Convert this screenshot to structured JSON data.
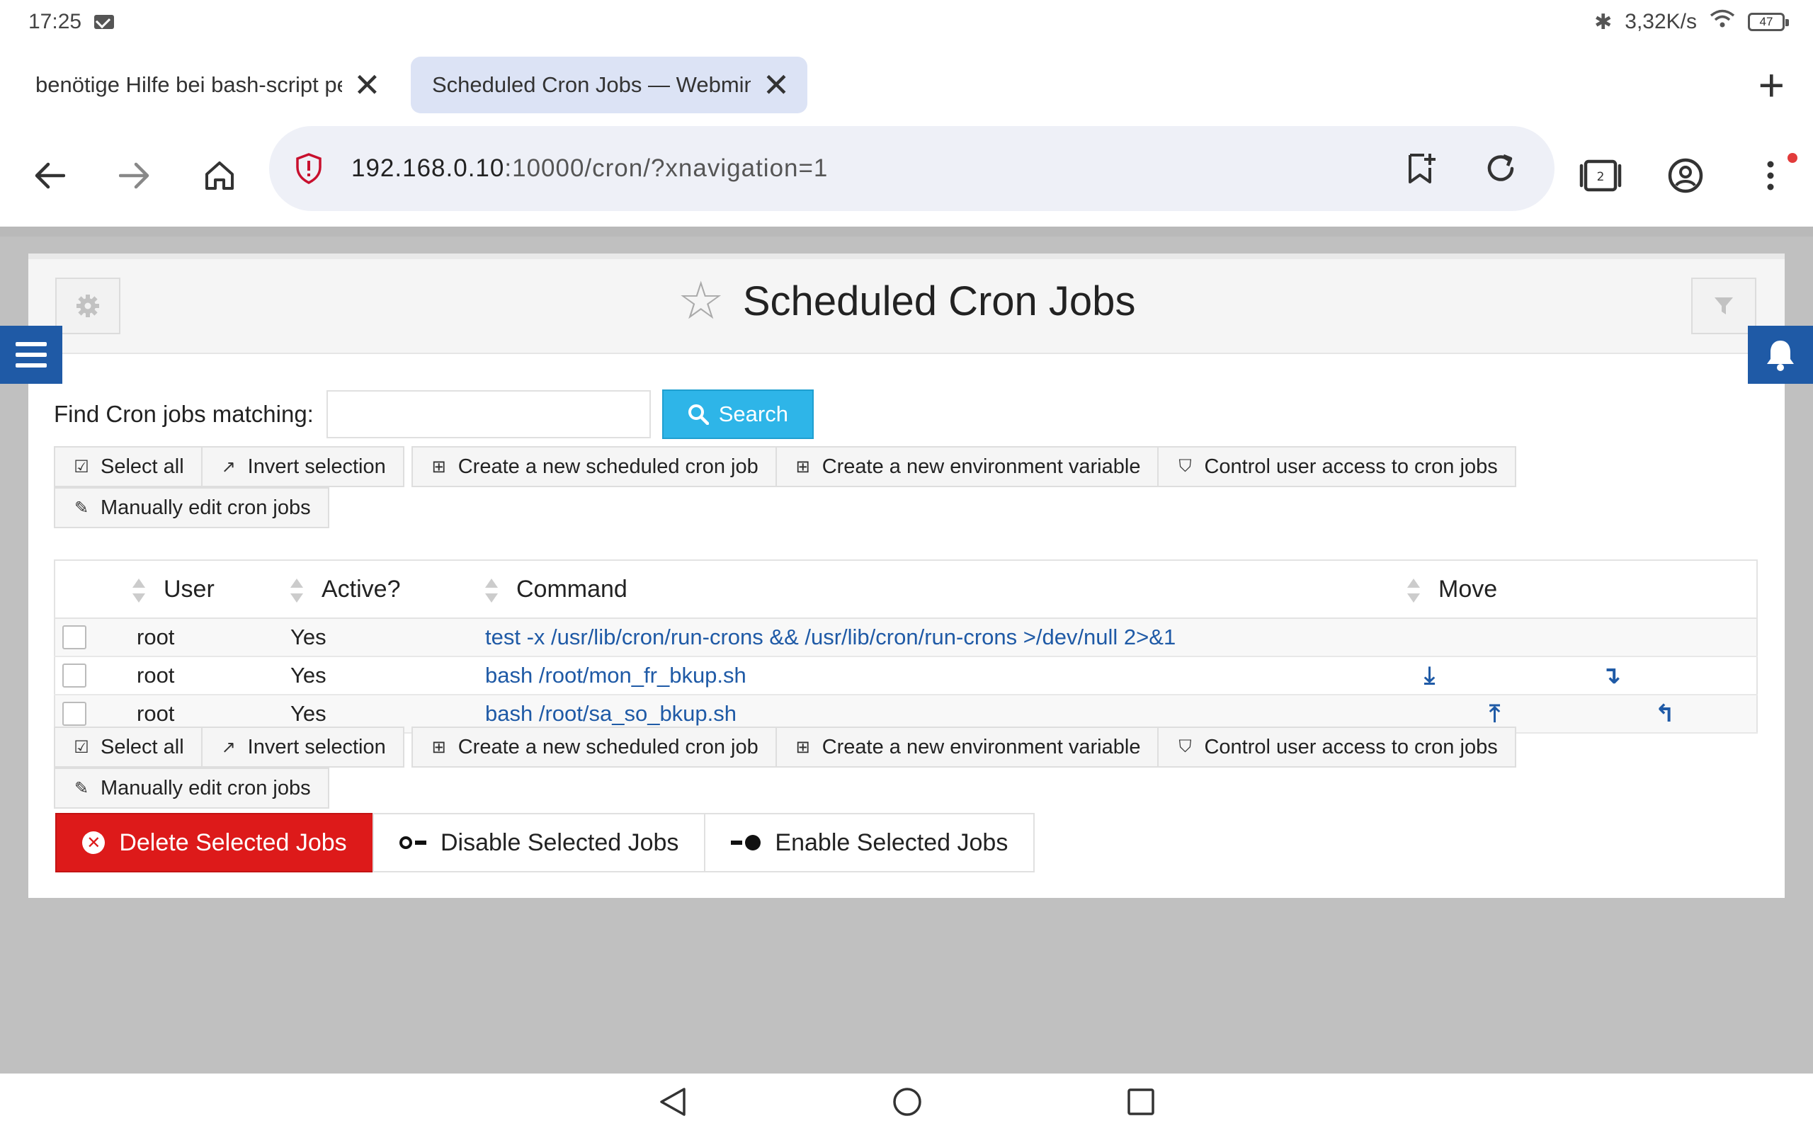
{
  "status_bar": {
    "time": "17:25",
    "net_speed": "3,32K/s",
    "battery": "47"
  },
  "tabs": [
    {
      "label": "benötige Hilfe bei bash-script per cron",
      "active": false
    },
    {
      "label": "Scheduled Cron Jobs — Webmin",
      "active": true
    }
  ],
  "address_bar": {
    "host": "192.168.0.10",
    "path": ":10000/cron/?xnavigation=1",
    "tab_count": "2"
  },
  "page": {
    "title": "Scheduled Cron Jobs",
    "search": {
      "label": "Find Cron jobs matching:",
      "value": "",
      "button": "Search"
    },
    "actions": {
      "select_all": "Select all",
      "invert_selection": "Invert selection",
      "create_job": "Create a new scheduled cron job",
      "create_env": "Create a new environment variable",
      "control_access": "Control user access to cron jobs",
      "manual_edit": "Manually edit cron jobs"
    },
    "table": {
      "headers": {
        "user": "User",
        "active": "Active?",
        "command": "Command",
        "move": "Move"
      },
      "rows": [
        {
          "user": "root",
          "active": "Yes",
          "command": "test -x /usr/lib/cron/run-crons && /usr/lib/cron/run-crons >/dev/null 2>&1"
        },
        {
          "user": "root",
          "active": "Yes",
          "command": "bash /root/mon_fr_bkup.sh"
        },
        {
          "user": "root",
          "active": "Yes",
          "command": "bash /root/sa_so_bkup.sh"
        }
      ]
    },
    "bulk": {
      "delete": "Delete Selected Jobs",
      "disable": "Disable Selected Jobs",
      "enable": "Enable Selected Jobs"
    }
  },
  "colors": {
    "accent": "#1f5aa6",
    "search": "#2eb5e8",
    "danger": "#dd1a1a",
    "active_tab": "#dce3f5"
  }
}
